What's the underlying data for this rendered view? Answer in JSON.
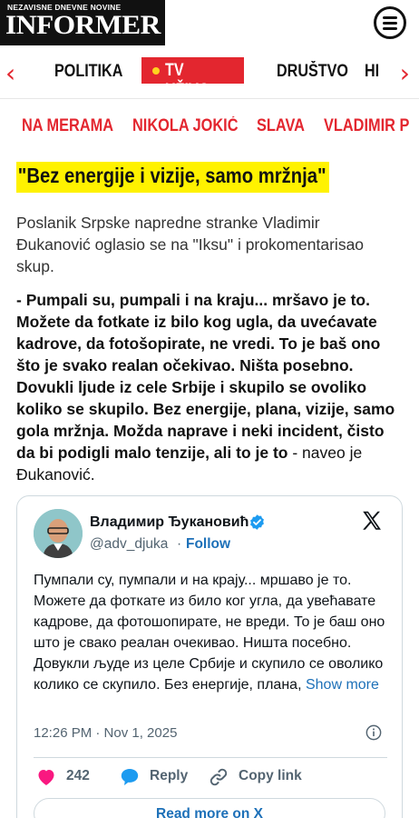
{
  "header": {
    "logo_tagline": "NEZAVISNE DNEVNE NOVINE",
    "logo_name": "INFORMER"
  },
  "nav": {
    "items": [
      "POLITIKA",
      "TV UŽIVO",
      "DRUŠTVO",
      "HI"
    ],
    "live_color": "#e3262f"
  },
  "tags": [
    "NA MERAMA",
    "NIKOLA JOKIĆ",
    "SLAVA",
    "VLADIMIR P"
  ],
  "article": {
    "headline": "\"Bez energije i vizije, samo mržnja\"",
    "intro": "Poslanik Srpske napredne stranke Vladimir Đukanović oglasio se na \"Iksu\" i prokomentarisao skup.",
    "quote_bold": "- Pumpali su, pumpali i na kraju... mršavo je to. Možete da fotkate iz bilo kog ugla, da uvećavate kadrove, da fotošopirate, ne vredi. To je baš ono što je svako realan očekivao. Ništa posebno. Dovukli ljude iz cele Srbije i skupilo se ovoliko koliko se skupilo. Bez energije, plana, vizije, samo gola mržnja. Možda naprave i neki incident, čisto da bi podigli malo tenzije, ali to je to",
    "quote_tail": " - naveo je Đukanović."
  },
  "tweet": {
    "author_name": "Владимир Ђукановић",
    "handle": "@adv_djuka",
    "separator": "·",
    "follow_label": "Follow",
    "text": "Пумпали су, пумпали и на крају... мршаво је то. Можете да фоткате из било ког угла, да увећавате кадрове, да фотошопирате, не вреди. То је баш оно што је свако реалан очекивао. Ништа посебно. Довукли људе из целе Србије и скупило се оволико колико се скупило. Без енергије, плана,",
    "show_more_label": "Show more",
    "timestamp": "12:26 PM · Nov 1, 2025",
    "likes_count": "242",
    "reply_label": "Reply",
    "copy_link_label": "Copy link",
    "read_more_label": "Read more on X"
  }
}
